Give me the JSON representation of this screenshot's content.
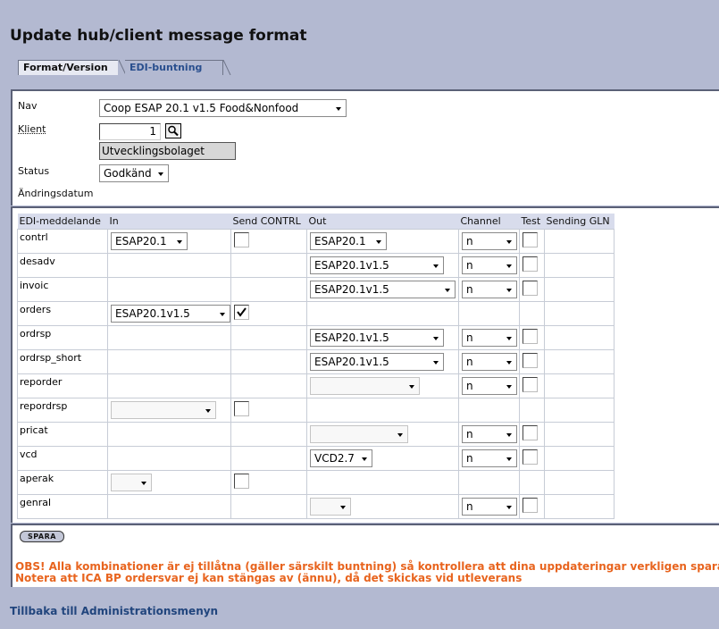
{
  "page": {
    "title": "Update hub/client message format",
    "tabs": [
      "Format/Version",
      "EDI-buntning"
    ]
  },
  "form": {
    "nav_label": "Nav",
    "nav_value": "Coop ESAP 20.1 v1.5 Food&Nonfood",
    "klient_label": "Klient",
    "klient_value": "1",
    "klient_name": "Utvecklingsbolaget",
    "status_label": "Status",
    "status_value": "Godkänd",
    "andringsdatum_label": "Ändringsdatum"
  },
  "grid": {
    "headers": [
      "EDI-meddelande",
      "In",
      "Send CONTRL",
      "Out",
      "Channel",
      "Test",
      "Sending GLN"
    ],
    "rows": [
      {
        "name": "contrl",
        "in": "ESAP20.1",
        "send_contrl": false,
        "out": "ESAP20.1",
        "channel": "n",
        "test": false
      },
      {
        "name": "desadv",
        "in": null,
        "send_contrl": null,
        "out": "ESAP20.1v1.5",
        "channel": "n",
        "test": false
      },
      {
        "name": "invoic",
        "in": null,
        "send_contrl": null,
        "out": "ESAP20.1v1.5",
        "channel": "n",
        "test": false
      },
      {
        "name": "orders",
        "in": "ESAP20.1v1.5",
        "send_contrl": true,
        "out": null,
        "channel": null,
        "test": null
      },
      {
        "name": "ordrsp",
        "in": null,
        "send_contrl": null,
        "out": "ESAP20.1v1.5",
        "channel": "n",
        "test": false
      },
      {
        "name": "ordrsp_short",
        "in": null,
        "send_contrl": null,
        "out": "ESAP20.1v1.5",
        "channel": "n",
        "test": false
      },
      {
        "name": "reporder",
        "in": null,
        "send_contrl": null,
        "out": "",
        "channel": "n",
        "test": false
      },
      {
        "name": "repordrsp",
        "in": "",
        "send_contrl": false,
        "out": null,
        "channel": null,
        "test": null
      },
      {
        "name": "pricat",
        "in": null,
        "send_contrl": null,
        "out": "",
        "channel": "n",
        "test": false
      },
      {
        "name": "vcd",
        "in": null,
        "send_contrl": null,
        "out": "VCD2.7",
        "channel": "n",
        "test": false
      },
      {
        "name": "aperak",
        "in": "",
        "send_contrl": false,
        "out": null,
        "channel": null,
        "test": null
      },
      {
        "name": "genral",
        "in": null,
        "send_contrl": null,
        "out": "",
        "channel": "n",
        "test": false
      }
    ]
  },
  "actions": {
    "save_label": "SPARA",
    "warning_1": "OBS! Alla kombinationer är ej tillåtna (gäller särskilt buntning) så kontrollera att dina uppdateringar verkligen sparas",
    "warning_2": "Notera att ICA BP ordersvar ej kan stängas av (ännu), då det skickas vid utleverans",
    "back_link": "Tillbaka till Administrationsmenyn"
  },
  "colors": {
    "background": "#b3b9d1",
    "header_row": "#d8dcec",
    "warning": "#e8641e",
    "link": "#21457d"
  }
}
